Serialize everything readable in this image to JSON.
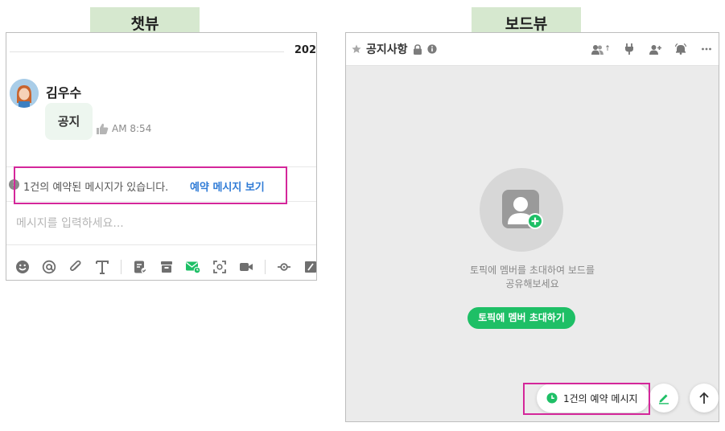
{
  "chat_view": {
    "tag": "챗뷰",
    "date_partial": "202",
    "sender": "김우수",
    "message": "공지",
    "message_time": "AM 8:54",
    "reserved_notice": "1건의 예약된 메시지가 있습니다.",
    "reserved_link": "예약 메시지 보기",
    "input_placeholder": "메시지를 입력하세요...",
    "toolbar_icons": [
      "emoji-icon",
      "mention-icon",
      "attach-icon",
      "text-format-icon",
      "todo-icon",
      "archive-icon",
      "reserved-send-icon",
      "screen-capture-icon",
      "video-call-icon",
      "translate-icon",
      "draw-icon"
    ]
  },
  "board_view": {
    "tag": "보드뷰",
    "title": "공지사항",
    "member_count_label": "↑",
    "empty_line_1": "토픽에 멤버를 초대하여 보드를",
    "empty_line_2": "공유해보세요",
    "invite_button": "토픽에 멤버 초대하기",
    "reserved_pill": "1건의 예약 메시지"
  },
  "colors": {
    "tag_bg": "#d6e8cf",
    "highlight": "#d4279a",
    "link_blue": "#2f7bd6",
    "accent_green": "#1ebf66"
  }
}
